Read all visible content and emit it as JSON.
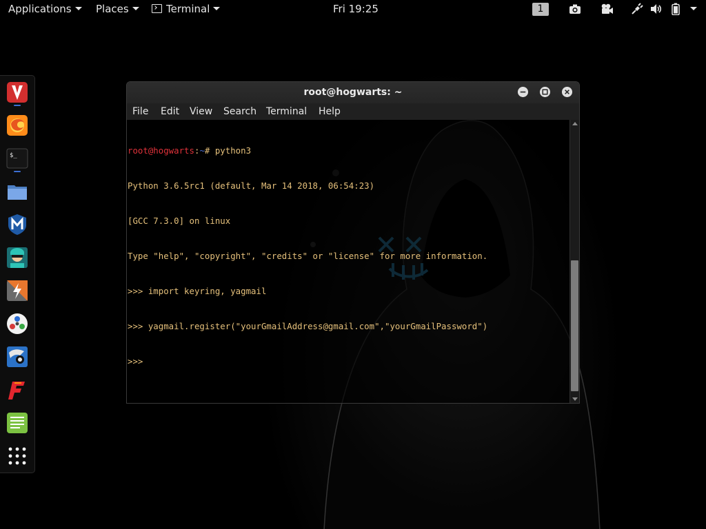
{
  "topbar": {
    "applications_label": "Applications",
    "places_label": "Places",
    "terminal_label": "Terminal",
    "clock": "Fri 19:25",
    "workspace": "1",
    "tray_icons": [
      "camera-icon",
      "video-camera-icon",
      "network-icon",
      "volume-icon",
      "battery-icon",
      "system-menu-caret-icon"
    ]
  },
  "dock": {
    "apps": [
      {
        "name": "vivaldi-icon",
        "color": "#d32f2f"
      },
      {
        "name": "firefox-icon",
        "color": "#ff8c1a"
      },
      {
        "name": "terminal-icon",
        "color": "#111111"
      },
      {
        "name": "files-icon",
        "color": "#5b8fd6"
      },
      {
        "name": "metasploit-icon",
        "color": "#1f5aa6"
      },
      {
        "name": "armitage-icon",
        "color": "#2aa8a0"
      },
      {
        "name": "burpsuite-icon",
        "color": "#e8772e"
      },
      {
        "name": "maltego-icon",
        "color": "#f0f0f0"
      },
      {
        "name": "beef-icon",
        "color": "#2b72c7"
      },
      {
        "name": "faraday-icon",
        "color": "#d32f2f"
      },
      {
        "name": "leafpad-icon",
        "color": "#7cc242"
      },
      {
        "name": "show-apps-icon",
        "color": "#ffffff"
      }
    ]
  },
  "window": {
    "title": "root@hogwarts: ~",
    "menu": [
      "File",
      "Edit",
      "View",
      "Search",
      "Terminal",
      "Help"
    ]
  },
  "terminal": {
    "prompt_user": "root@hogwarts",
    "prompt_sep": ":",
    "prompt_path": "~",
    "prompt_hash": "# ",
    "command": "python3",
    "lines": [
      "Python 3.6.5rc1 (default, Mar 14 2018, 06:54:23)",
      "[GCC 7.3.0] on linux",
      "Type \"help\", \"copyright\", \"credits\" or \"license\" for more information.",
      ">>> import keyring, yagmail",
      ">>> yagmail.register(\"yourGmailAddress@gmail.com\",\"yourGmailPassword\")",
      ">>> "
    ]
  },
  "colors": {
    "prompt_user": "#e0323a",
    "prompt_path": "#4a6cd3",
    "text": "#e5c07b",
    "dock_running_indicator": "#3c6fd4"
  }
}
